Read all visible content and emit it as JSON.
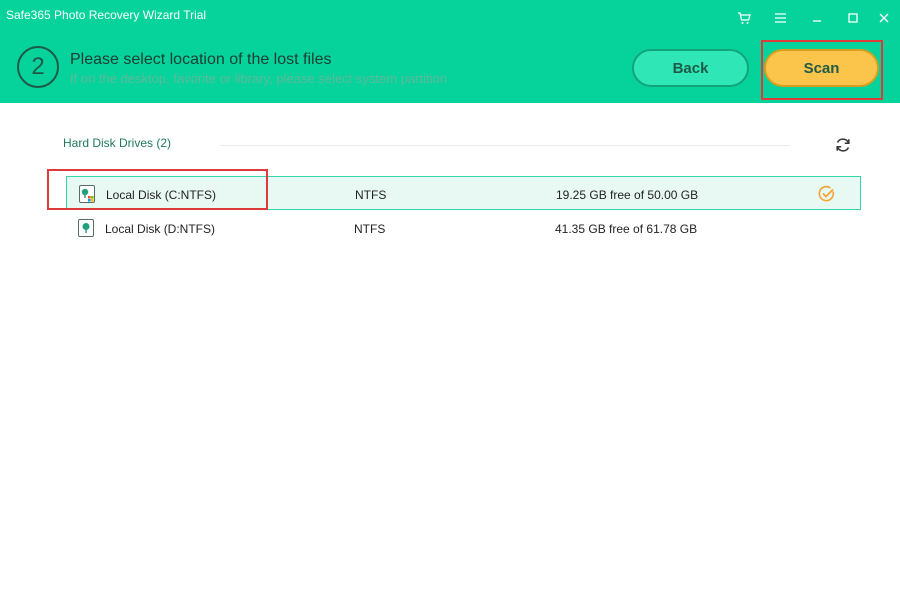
{
  "window": {
    "title": "Safe365 Photo Recovery Wizard Trial",
    "controls": [
      "cart-icon",
      "menu-icon",
      "minimize-icon",
      "maximize-icon",
      "close-icon"
    ]
  },
  "step": {
    "number": "2",
    "title": "Please select location of the lost files",
    "subtitle": "If on the desktop, favorite or library, please select system partition"
  },
  "buttons": {
    "back": "Back",
    "scan": "Scan"
  },
  "section": {
    "label": "Hard Disk Drives (2)"
  },
  "drives": [
    {
      "name": "Local Disk (C:NTFS)",
      "filesystem": "NTFS",
      "space": "19.25 GB free of 50.00 GB",
      "selected": true
    },
    {
      "name": "Local Disk (D:NTFS)",
      "filesystem": "NTFS",
      "space": "41.35 GB free of 61.78 GB",
      "selected": false
    }
  ],
  "colors": {
    "header_bg": "#05d39b",
    "scan_button": "#fbc44a",
    "back_button": "#2ee6b6",
    "selected_row_bg": "#e8f9f3",
    "highlight_box": "#dd3b3b",
    "check": "#f3a330"
  }
}
